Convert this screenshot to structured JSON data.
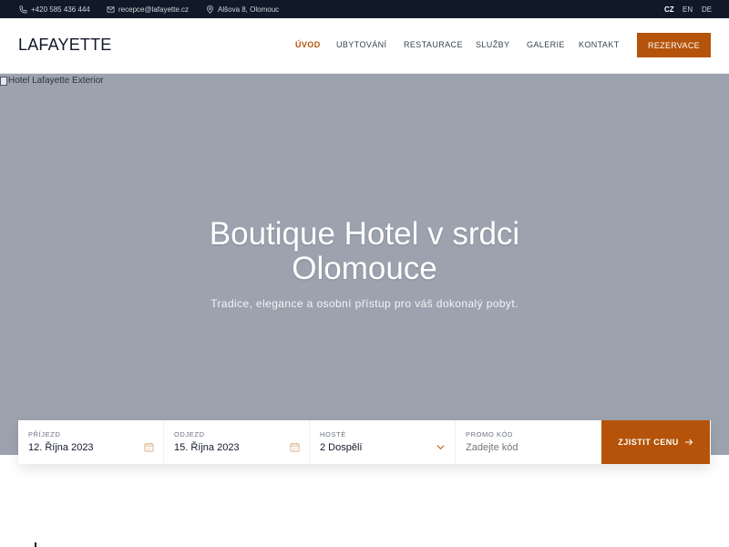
{
  "topbar": {
    "phone": "+420 585 436 444",
    "email": "recepce@lafayette.cz",
    "address": "Alšova 8, Olomouc",
    "languages": [
      "CZ",
      "EN",
      "DE"
    ],
    "active_language": "CZ"
  },
  "header": {
    "logo": "LAFAYETTE",
    "nav": [
      "ÚVOD",
      "UBYTOVÁNÍ",
      "RESTAURACE",
      "SLUŽBY",
      "GALERIE",
      "KONTAKT"
    ],
    "active_nav": "ÚVOD",
    "reserve_label": "REZERVACE"
  },
  "hero": {
    "image_alt": "Hotel Lafayette Exterior",
    "title_line1": "Boutique Hotel v srdci",
    "title_line2": "Olomouce",
    "subtitle": "Tradice, elegance a osobní přístup pro váš dokonalý pobyt."
  },
  "booking": {
    "arrival_label": "PŘÍJEZD",
    "arrival_value": "12. Října 2023",
    "departure_label": "ODJEZD",
    "departure_value": "15. Října 2023",
    "guests_label": "HOSTÉ",
    "guests_value": "2 Dospělí",
    "promo_label": "PROMO KÓD",
    "promo_placeholder": "Zadejte kód",
    "submit_label": "ZJISTIT CENU"
  },
  "colors": {
    "accent": "#b45309",
    "topbar": "#111827",
    "hero_bg": "#9ca3af"
  }
}
